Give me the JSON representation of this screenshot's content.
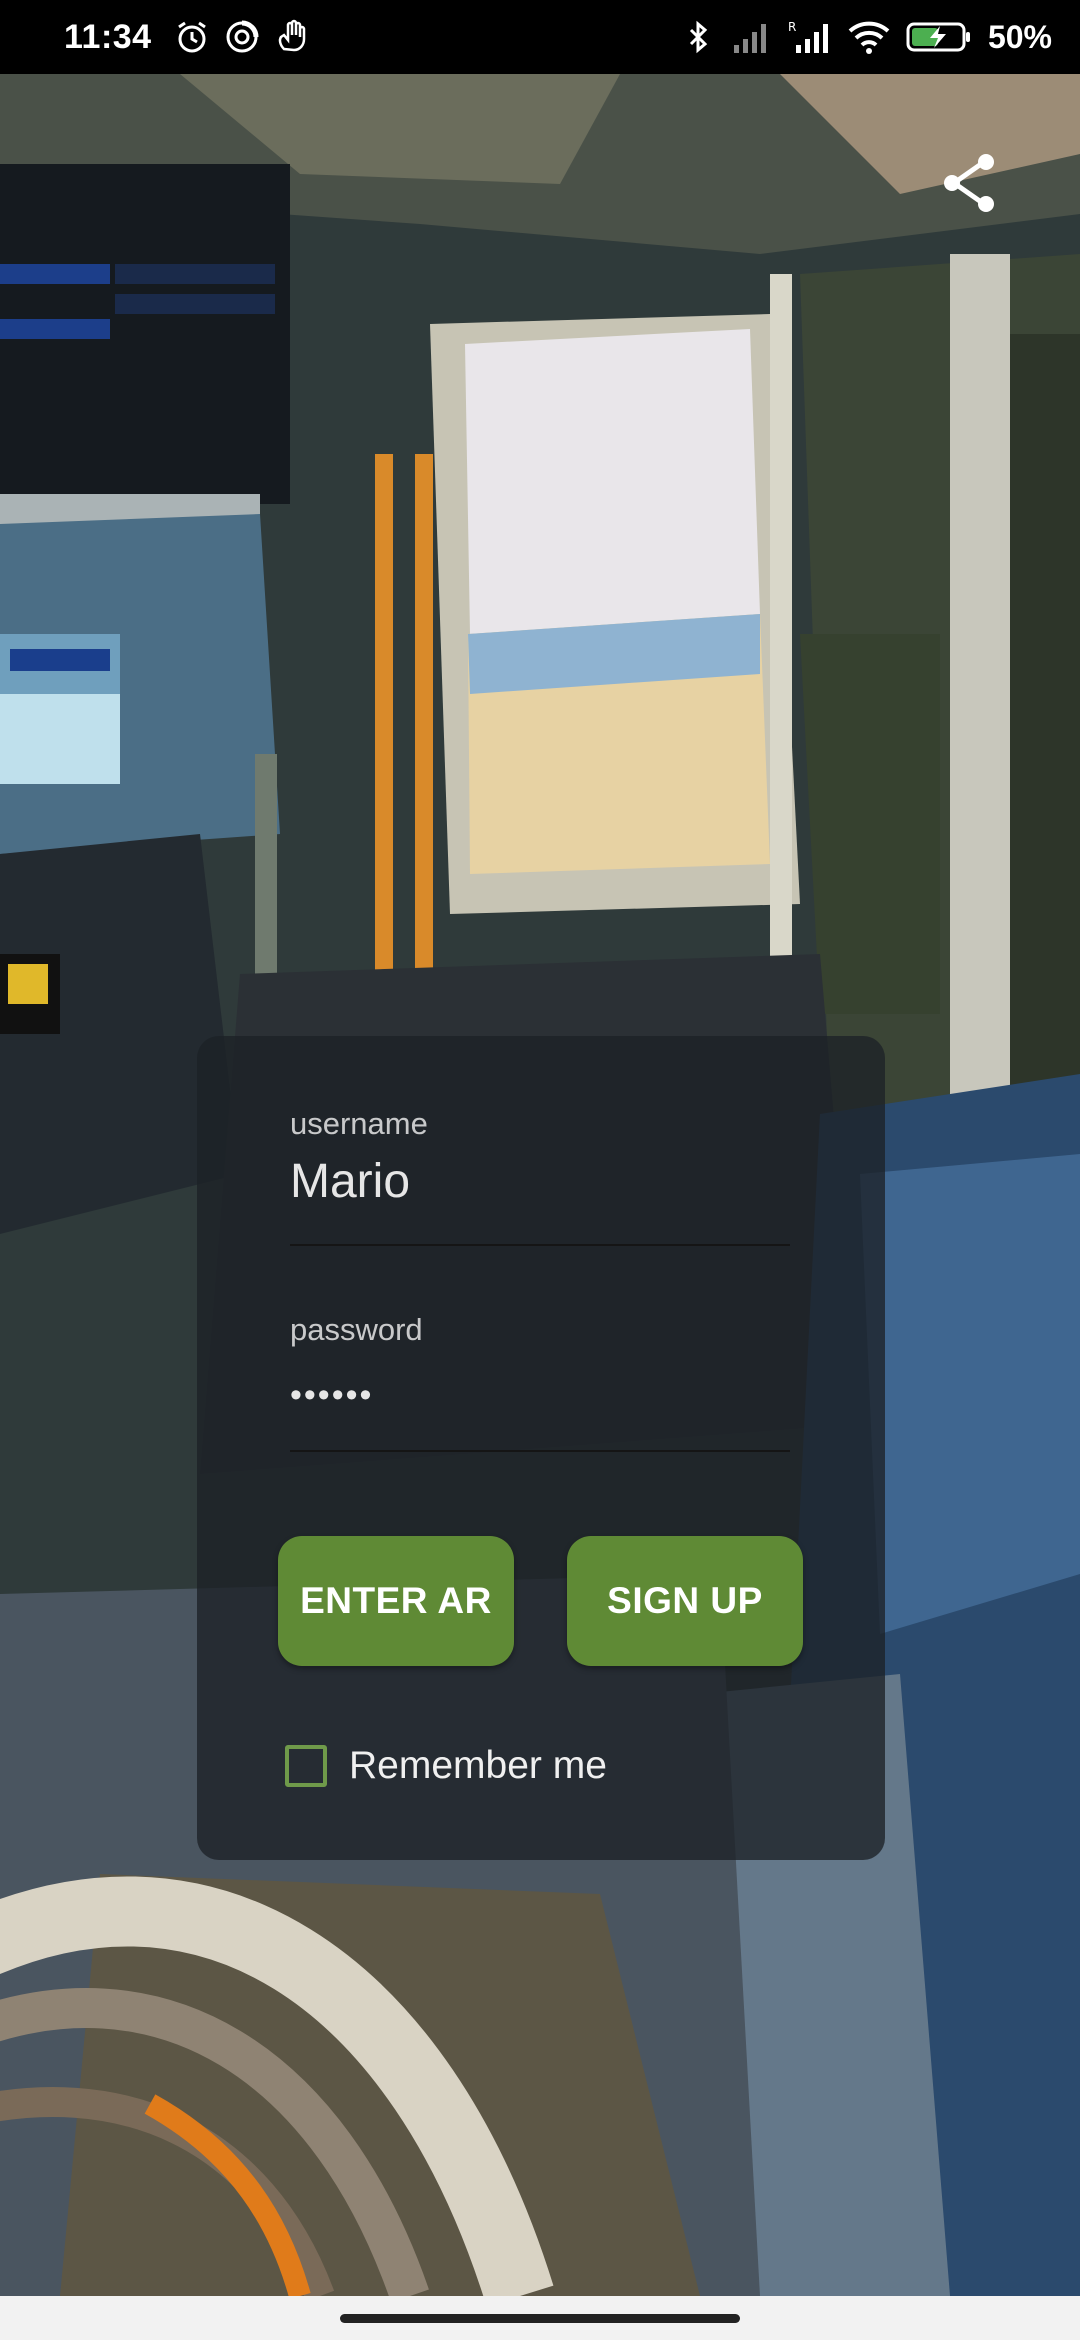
{
  "status_bar": {
    "time": "11:34",
    "battery_percent": "50%",
    "left_icons": [
      "alarm-icon",
      "dnd-icon",
      "gesture-icon"
    ],
    "right_icons": [
      "bluetooth-icon",
      "signal-icon",
      "signal-roaming-icon",
      "wifi-icon",
      "battery-charging-icon"
    ]
  },
  "top_actions": {
    "share_icon": "share-icon"
  },
  "login": {
    "username_label": "username",
    "username_value": "Mario",
    "password_label": "password",
    "password_value": "••••••",
    "enter_ar_label": "ENTER AR",
    "sign_up_label": "SIGN UP",
    "remember_me_label": "Remember me",
    "remember_me_checked": false
  },
  "colors": {
    "button": "#5f8a35",
    "checkbox_border": "#6f9a4a",
    "card": "#1c2126"
  }
}
